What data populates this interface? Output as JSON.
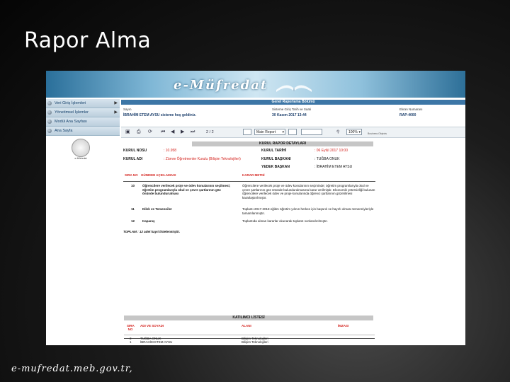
{
  "slide": {
    "title": "Rapor Alma",
    "footer": "e-mufredat.meb.gov.tr,"
  },
  "app": {
    "brand": "e-Müfredat",
    "section_header": "Genel Raporlama Bölümü",
    "welcome_label": "Sayın",
    "welcome_text": "İBRAHİM ETEM AYSU sisteme hoş geldiniz.",
    "datetime_label": "Sisteme Giriş Tarih ve Saati",
    "datetime_value": "30 Kasım 2017 13:44",
    "screen_no_label": "Ekran Numarası",
    "screen_no_value": "RAP-4000"
  },
  "sidebar": {
    "items": [
      {
        "label": "Veri Giriş İşlemleri",
        "arrow": "▶"
      },
      {
        "label": "Yönetimsel İşlemler",
        "arrow": "▶"
      },
      {
        "label": "Modül Ana Sayfası",
        "arrow": ""
      },
      {
        "label": "Ana Sayfa",
        "arrow": ""
      }
    ],
    "logo_text": "e-Müfredat"
  },
  "toolbar": {
    "page_indicator": "2 / 2",
    "report_select": "Main Report",
    "zoom_select": "100%",
    "powered_by": "Business Objects"
  },
  "report": {
    "title": "KURUL RAPOR DETAYLARI",
    "fields": {
      "kurul_no_label": "KURUL NOSU",
      "kurul_no_value": ": 10.958",
      "kurul_tarihi_label": "KURUL TARİHİ",
      "kurul_tarihi_value": ": 06 Eylül 2017 10:00",
      "kurul_adi_label": "KURUL ADI",
      "kurul_adi_value": ": Zümre Öğretmenler Kurulu (Bilişim Teknolojileri)",
      "kurul_baskani_label": "KURUL BAŞKANI",
      "kurul_baskani_value": ": TUĞBA ONUK",
      "yedek_baskan_label": "YEDEK BAŞKAN",
      "yedek_baskan_value": ": İBRAHİM ETEM AYSU"
    },
    "columns": [
      "SIRA NO",
      "GÜNDEM AÇIKLAMASI",
      "KARAR METNİ"
    ],
    "rows": [
      {
        "no": "10",
        "agenda": "Öğrencilere verilecek proje ve ödev konularının seçilmesi; öğretim programlarıyla okul ve çevre şartlarının göz önünde bulundurulması",
        "decision": "Öğrencilere verilecek proje ve ödev konularının seçiminde; öğretim programlarıyla okul ve çevre şartlarının göz önünde bulundurulmasına karar verilmiştir. Ekonomik yetersizliği bulunan öğrencilere verilecek ödev ve proje konularında öğrenci şartlarının gözetilmesi kararlaştırılmıştır."
      },
      {
        "no": "11",
        "agenda": "Dilek ve Temenniler",
        "decision": "Toplantı 2017-2018 eğitim öğretim yılının herkes için başarılı ve hayırlı olması temenniyleriyle tamamlanmıştır."
      },
      {
        "no": "12",
        "agenda": "Kapanış",
        "decision": "Toplantıda alınan kararlar okunarak toplantı sonlandırılmıştır."
      }
    ],
    "total": "TOPLAM : 12 adet kayıt listelenmiştir."
  },
  "participants": {
    "title": "KATILIMCI LİSTESİ",
    "columns": [
      "SIRA NO",
      "ADI VE SOYADI",
      "ALANI",
      "İMZASI"
    ],
    "rows": [
      {
        "no": "1",
        "name": "İBRAHİM ETEM AYSU",
        "field": "Bilişim Teknolojileri"
      },
      {
        "no": "2",
        "name": "TUĞBA ONUK",
        "field": "Bilişim Teknolojileri"
      }
    ]
  },
  "colors": {
    "accent_blue": "#3c76a6",
    "label_red": "#d4231e",
    "slide_bg": "#1c1c1c"
  }
}
